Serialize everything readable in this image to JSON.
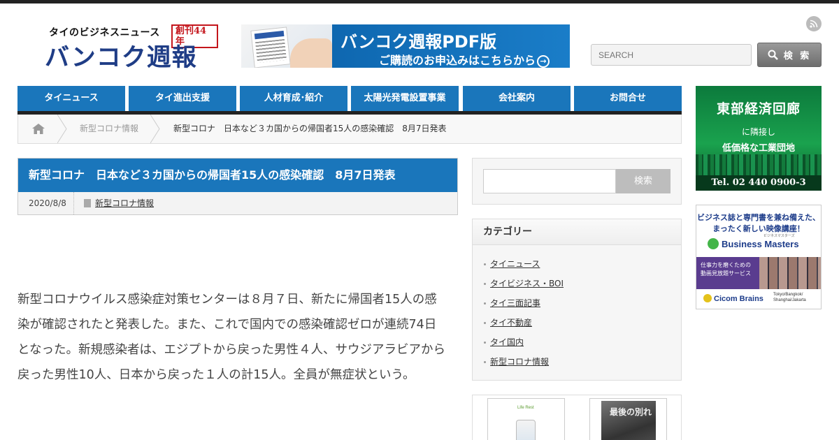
{
  "header": {
    "logo_sub": "タイのビジネスニュース",
    "logo_badge": "創刊44年",
    "logo_main": "バンコク週報",
    "banner_title": "バンコク週報PDF版",
    "banner_cta": "ご購読のお申込みはこちらから",
    "banner_arrow": "→",
    "search_placeholder": "SEARCH",
    "search_button": "検 索"
  },
  "nav": {
    "items": [
      {
        "label": "タイニュース"
      },
      {
        "label": "タイ進出支援"
      },
      {
        "label": "人材育成･紹介"
      },
      {
        "label": "太陽光発電設置事業"
      },
      {
        "label": "会社案内"
      },
      {
        "label": "お問合せ"
      }
    ]
  },
  "breadcrumb": {
    "category": "新型コロナ情報",
    "current": "新型コロナ　日本など３カ国からの帰国者15人の感染確認　8月7日発表"
  },
  "article": {
    "title": "新型コロナ　日本など３カ国からの帰国者15人の感染確認　8月7日発表",
    "date": "2020/8/8",
    "category": "新型コロナ情報",
    "body_lines": [
      "新型コロナウイルス感染症対策センターは８月７日、新たに帰国者15人の感",
      "染が確認されたと発表した。また、これで国内での感染確認ゼロが連続74日",
      "となった。新規感染者は、エジプトから戻った男性４人、サウジアラビアから",
      "戻った男性10人、日本から戻った１人の計15人。全員が無症状という。"
    ]
  },
  "sidebar": {
    "search_button": "検索",
    "categories_title": "カテゴリー",
    "categories": [
      {
        "label": "タイニュース"
      },
      {
        "label": "タイビジネス・BOI"
      },
      {
        "label": "タイ三面記事"
      },
      {
        "label": "タイ不動産"
      },
      {
        "label": "タイ国内"
      },
      {
        "label": "新型コロナ情報"
      }
    ],
    "ad1_label": "Life Rest",
    "ad2_text": "最後の別れ"
  },
  "right_ads": {
    "tobu_title": "東部経済回廊",
    "tobu_line1": "に隣接し",
    "tobu_line2": "低価格な工業団地",
    "tobu_tel": "Tel. 02 440 0900-3",
    "bm_line1": "ビジネス誌と専門書を兼ね備えた、",
    "bm_line2": "まったく新しい映像講座！",
    "bm_small": "ビジネスマスターズ",
    "bm_logo": "Business Masters",
    "bm_promo1": "仕事力を磨くための",
    "bm_promo2": "動画見放題サービス",
    "bm_cicom": "Cicom Brains",
    "bm_cities1": "Tokyo/Bangkok/",
    "bm_cities2": "Shanghai/Jakarta"
  },
  "colors": {
    "nav_blue": "#1a76bb",
    "logo_navy": "#1f3d86",
    "badge_red": "#c4161c",
    "ad_green": "#1aa24e"
  },
  "icons": [
    "rss-icon",
    "search-icon",
    "home-icon",
    "document-icon",
    "arrow-circle-icon"
  ]
}
